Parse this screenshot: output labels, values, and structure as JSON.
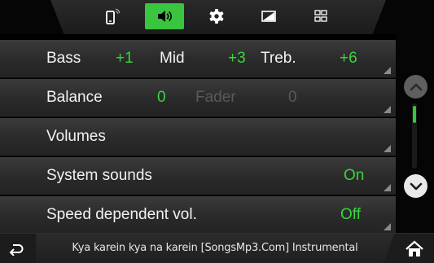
{
  "tabs": [
    {
      "name": "phone-icon",
      "active": false
    },
    {
      "name": "speaker-icon",
      "active": true
    },
    {
      "name": "gear-icon",
      "active": false
    },
    {
      "name": "display-icon",
      "active": false
    },
    {
      "name": "grid-icon",
      "active": false
    }
  ],
  "rows": {
    "tone": {
      "bass_label": "Bass",
      "bass_value": "+1",
      "mid_label": "Mid",
      "mid_value": "+3",
      "treble_label": "Treb.",
      "treble_value": "+6"
    },
    "balance": {
      "label": "Balance",
      "value": "0",
      "fader_label": "Fader",
      "fader_value": "0"
    },
    "volumes": {
      "label": "Volumes"
    },
    "system_sounds": {
      "label": "System sounds",
      "value": "On"
    },
    "speed_volume": {
      "label": "Speed dependent vol.",
      "value": "Off"
    }
  },
  "now_playing": "Kya karein kya na karein [SongsMp3.Com] Instrumental",
  "colors": {
    "accent": "#39c53f",
    "value_text": "#3ad43f",
    "row_bg": "#2e2e2e"
  }
}
